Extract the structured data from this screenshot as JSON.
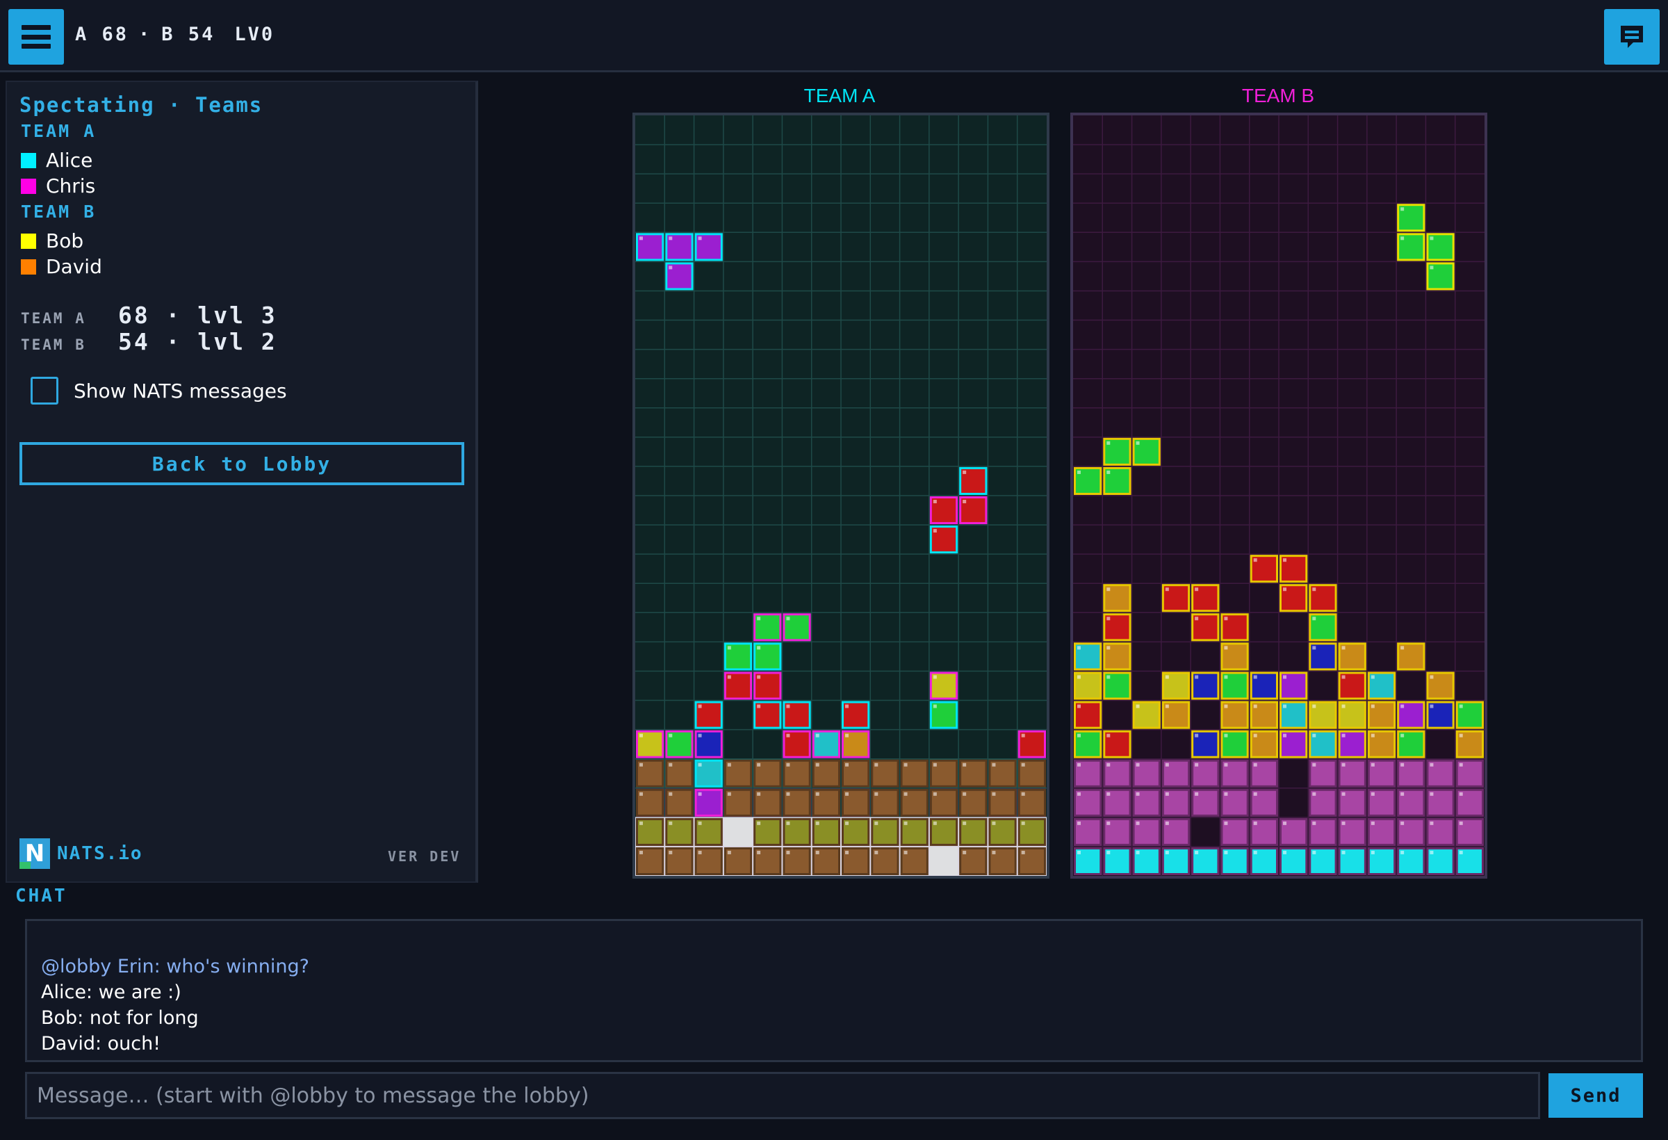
{
  "topbar": {
    "menu_icon": "hamburger-menu-icon",
    "chat_icon": "chat-bubble-icon",
    "score_a": "A 68",
    "separator": "·",
    "score_b": "B 54",
    "level": "LV0"
  },
  "sidebar": {
    "title": "Spectating · Teams",
    "teams": [
      {
        "name": "TEAM A",
        "players": [
          {
            "name": "Alice",
            "color": "#00f0ff"
          },
          {
            "name": "Chris",
            "color": "#ff00e6"
          }
        ]
      },
      {
        "name": "TEAM B",
        "players": [
          {
            "name": "Bob",
            "color": "#ffff00"
          },
          {
            "name": "David",
            "color": "#ff8000"
          }
        ]
      }
    ],
    "scores": [
      {
        "label": "TEAM A",
        "value": "68 · lvl 3"
      },
      {
        "label": "TEAM B",
        "value": "54 · lvl 2"
      }
    ],
    "nats_toggle": {
      "label": "Show NATS messages",
      "checked": false
    },
    "back_button": "Back to Lobby",
    "logo_text": "NATS.io",
    "version": "VER DEV"
  },
  "boards": {
    "cols": 14,
    "rows": 26,
    "team_a": {
      "title": "TEAM A",
      "title_color": "#00e5f5",
      "bg": "#0e2424",
      "grid": "#1e4a48",
      "grid_rows": [
        "..............",
        "..............",
        "..............",
        "..............",
        "PPP...........",
        ".P............",
        "..............",
        "..............",
        "..............",
        "..............",
        "..............",
        "..............",
        "...........R..",
        "..........RR..",
        "..........R...",
        "..............",
        "..............",
        "....GG........",
        "...GG.........",
        "...RR.....Y...",
        "..R.RR.R..G...",
        "YGB..RCO.....R",
        "GBCCCY.C..G.BB",
        "YPPYRBGO..C.BP",
        "WWWWWWWWWWWWWW",
        "WWWWWWWWWWWWWW"
      ],
      "garbage_rows": [
        "BB.BBBBBBBBBBB",
        "BB.BBBBBBBBBBB",
        "OOO.OOOOOOOOOO",
        "BBBBBBBBBB.BBB"
      ]
    },
    "team_b": {
      "title": "TEAM B",
      "title_color": "#f020d8",
      "bg": "#1e0f22",
      "grid": "#3d1a40",
      "grid_rows": [
        "..............",
        "..............",
        "..............",
        "..............",
        "..............",
        "..............",
        "..............",
        "..............",
        "..............",
        "..............",
        "..............",
        "..............",
        "..............",
        "..............",
        "..............",
        "..............",
        "..............",
        "..............",
        "..............",
        "..............",
        "..............",
        "..............",
        "..............",
        "..............",
        "..............",
        ".............."
      ],
      "falling_piece": [
        [
          11,
          3
        ],
        [
          11,
          4
        ],
        [
          12,
          4
        ],
        [
          12,
          5
        ]
      ],
      "stack_rows": [
        ".GG...........",
        "GG............",
        "..............",
        "..............",
        "......RR......",
        ".O.RR..RR.....",
        ".R..RR..G.....",
        "CO...O..BO.O..",
        "YG.YBGBP.RC.O.",
        "R.YO.OOCYYOPBG",
        "GR..BGOPCPOG.O"
      ],
      "garbage_rows": [
        "MMMMMMM.MMMMMM",
        "MMMMMMM.MMMMMM",
        "MMMM.MMMMMMMMM",
        "CCCCCCCCCCCCCC"
      ]
    },
    "colors": {
      "P": "#9b1fd0",
      "R": "#c91818",
      "G": "#1fcf3a",
      "Y": "#c7c21a",
      "B": "#1a23b8",
      "C": "#20c0c8",
      "O": "#c98a18",
      "W": "#f0f0f2",
      "M": "#a845a4",
      "Bn": "#8a5a2e",
      "Ol": "#8a8f25",
      "Cy": "#18e0e8"
    }
  },
  "chat": {
    "title": "CHAT",
    "messages": [
      {
        "text": "@lobby Erin: who's winning?",
        "lobby": true
      },
      {
        "text": "Alice: we are :)",
        "lobby": false
      },
      {
        "text": "Bob: not for long",
        "lobby": false
      },
      {
        "text": "David: ouch!",
        "lobby": false
      }
    ],
    "input_placeholder": "Message… (start with @lobby to message the lobby)",
    "send_label": "Send"
  }
}
